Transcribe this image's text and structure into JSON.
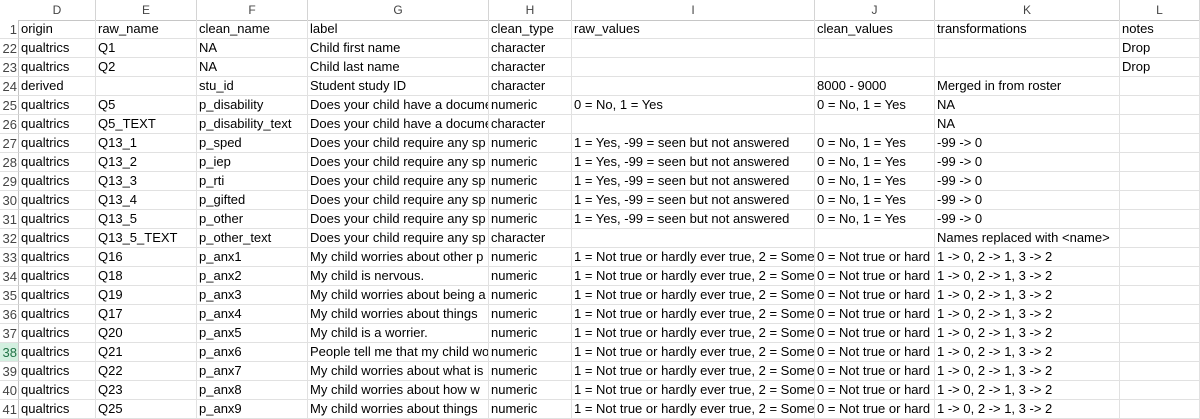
{
  "columns": [
    "D",
    "E",
    "F",
    "G",
    "H",
    "I",
    "J",
    "K",
    "L"
  ],
  "rows": [
    {
      "num": "1",
      "cells": [
        "origin",
        "raw_name",
        "clean_name",
        "label",
        "clean_type",
        "raw_values",
        "clean_values",
        "transformations",
        "notes"
      ]
    },
    {
      "num": "22",
      "cells": [
        "qualtrics",
        "Q1",
        "NA",
        "Child first name",
        "character",
        "",
        "",
        "",
        "Drop"
      ]
    },
    {
      "num": "23",
      "cells": [
        "qualtrics",
        "Q2",
        "NA",
        "Child last name",
        "character",
        "",
        "",
        "",
        "Drop"
      ]
    },
    {
      "num": "24",
      "cells": [
        "derived",
        "",
        "stu_id",
        "Student study ID",
        "character",
        "",
        "8000 - 9000",
        "Merged in from roster",
        ""
      ]
    },
    {
      "num": "25",
      "cells": [
        "qualtrics",
        "Q5",
        "p_disability",
        "Does your child have a docume",
        "numeric",
        "0 = No, 1 = Yes",
        "0 = No, 1 = Yes",
        "NA",
        ""
      ]
    },
    {
      "num": "26",
      "cells": [
        "qualtrics",
        "Q5_TEXT",
        "p_disability_text",
        "Does your child have a docume",
        "character",
        "",
        "",
        "NA",
        ""
      ]
    },
    {
      "num": "27",
      "cells": [
        "qualtrics",
        "Q13_1",
        "p_sped",
        "Does your child require any sp",
        "numeric",
        "1 = Yes, -99 = seen but not answered",
        "0 = No, 1 = Yes",
        "-99 -> 0",
        ""
      ]
    },
    {
      "num": "28",
      "cells": [
        "qualtrics",
        "Q13_2",
        "p_iep",
        "Does your child require any sp",
        "numeric",
        "1 = Yes, -99 = seen but not answered",
        "0 = No, 1 = Yes",
        "-99 -> 0",
        ""
      ]
    },
    {
      "num": "29",
      "cells": [
        "qualtrics",
        "Q13_3",
        "p_rti",
        "Does your child require any sp",
        "numeric",
        "1 = Yes, -99 = seen but not answered",
        "0 = No, 1 = Yes",
        "-99 -> 0",
        ""
      ]
    },
    {
      "num": "30",
      "cells": [
        "qualtrics",
        "Q13_4",
        "p_gifted",
        "Does your child require any sp",
        "numeric",
        "1 = Yes, -99 = seen but not answered",
        "0 = No, 1 = Yes",
        "-99 -> 0",
        ""
      ]
    },
    {
      "num": "31",
      "cells": [
        "qualtrics",
        "Q13_5",
        "p_other",
        "Does your child require any sp",
        "numeric",
        "1 = Yes, -99 = seen but not answered",
        "0 = No, 1 = Yes",
        "-99 -> 0",
        ""
      ]
    },
    {
      "num": "32",
      "cells": [
        "qualtrics",
        "Q13_5_TEXT",
        "p_other_text",
        "Does your child require any sp",
        "character",
        "",
        "",
        "Names replaced with <name>",
        ""
      ]
    },
    {
      "num": "33",
      "cells": [
        "qualtrics",
        "Q16",
        "p_anx1",
        "My child worries about other p",
        "numeric",
        "1 = Not true or hardly ever true, 2 = Some",
        "0 = Not true or hard",
        "1 -> 0, 2 -> 1, 3 -> 2",
        ""
      ]
    },
    {
      "num": "34",
      "cells": [
        "qualtrics",
        "Q18",
        "p_anx2",
        "My child is nervous.",
        "numeric",
        "1 = Not true or hardly ever true, 2 = Some",
        "0 = Not true or hard",
        "1 -> 0, 2 -> 1, 3 -> 2",
        ""
      ]
    },
    {
      "num": "35",
      "cells": [
        "qualtrics",
        "Q19",
        "p_anx3",
        "My child worries about being a",
        "numeric",
        "1 = Not true or hardly ever true, 2 = Some",
        "0 = Not true or hard",
        "1 -> 0, 2 -> 1, 3 -> 2",
        ""
      ]
    },
    {
      "num": "36",
      "cells": [
        "qualtrics",
        "Q17",
        "p_anx4",
        "My child worries about things ",
        "numeric",
        "1 = Not true or hardly ever true, 2 = Some",
        "0 = Not true or hard",
        "1 -> 0, 2 -> 1, 3 -> 2",
        ""
      ]
    },
    {
      "num": "37",
      "cells": [
        "qualtrics",
        "Q20",
        "p_anx5",
        "My child is a worrier.",
        "numeric",
        "1 = Not true or hardly ever true, 2 = Some",
        "0 = Not true or hard",
        "1 -> 0, 2 -> 1, 3 -> 2",
        ""
      ]
    },
    {
      "num": "38",
      "cells": [
        "qualtrics",
        "Q21",
        "p_anx6",
        "People tell me that my child wo",
        "numeric",
        "1 = Not true or hardly ever true, 2 = Some",
        "0 = Not true or hard",
        "1 -> 0, 2 -> 1, 3 -> 2",
        ""
      ]
    },
    {
      "num": "39",
      "cells": [
        "qualtrics",
        "Q22",
        "p_anx7",
        "My child worries about what is",
        "numeric",
        "1 = Not true or hardly ever true, 2 = Some",
        "0 = Not true or hard",
        "1 -> 0, 2 -> 1, 3 -> 2",
        ""
      ]
    },
    {
      "num": "40",
      "cells": [
        "qualtrics",
        "Q23",
        "p_anx8",
        "My child worries about how w",
        "numeric",
        "1 = Not true or hardly ever true, 2 = Some",
        "0 = Not true or hard",
        "1 -> 0, 2 -> 1, 3 -> 2",
        ""
      ]
    },
    {
      "num": "41",
      "cells": [
        "qualtrics",
        "Q25",
        "p_anx9",
        "My child worries about things ",
        "numeric",
        "1 = Not true or hardly ever true, 2 = Some",
        "0 = Not true or hard",
        "1 -> 0, 2 -> 1, 3 -> 2",
        ""
      ]
    }
  ],
  "selected_row": "38",
  "colors": {
    "accent": "#217346",
    "gridline": "#e1e1e1",
    "selected_header_bg": "#d3f0e0"
  }
}
